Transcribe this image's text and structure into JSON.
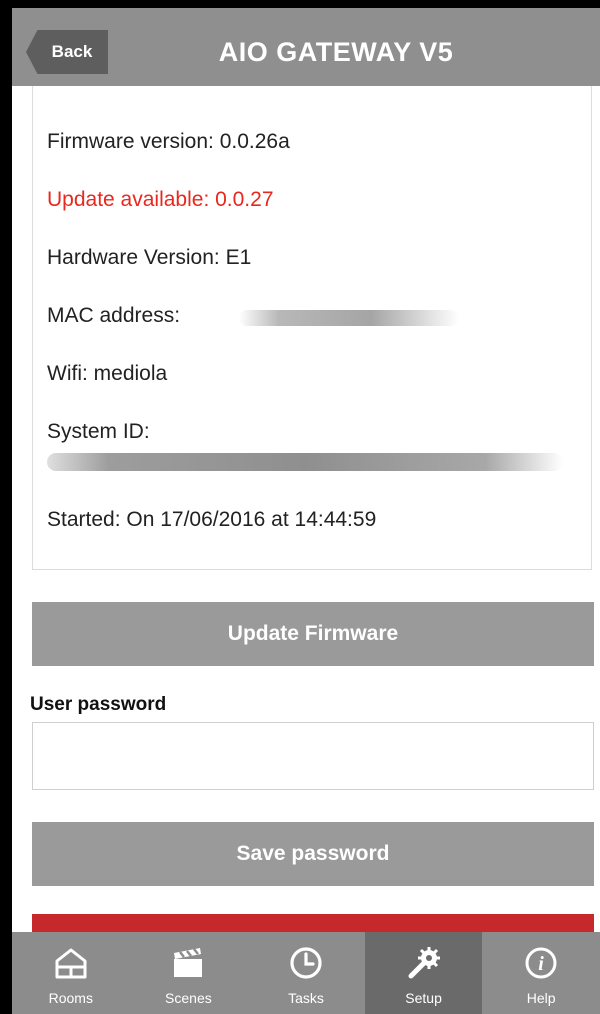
{
  "header": {
    "back_label": "Back",
    "title": "AIO GATEWAY V5"
  },
  "info": {
    "firmware": "Firmware version: 0.0.26a",
    "update": "Update available: 0.0.27",
    "hardware": "Hardware Version: E1",
    "mac_label": "MAC address:",
    "wifi": "Wifi: mediola",
    "system_id_label": "System ID:",
    "started": "Started: On 17/06/2016 at 14:44:59"
  },
  "buttons": {
    "update_firmware": "Update Firmware",
    "save_password": "Save password"
  },
  "password": {
    "label": "User password",
    "value": ""
  },
  "tabs": [
    {
      "label": "Rooms",
      "icon": "house-icon"
    },
    {
      "label": "Scenes",
      "icon": "clapperboard-icon"
    },
    {
      "label": "Tasks",
      "icon": "clock-icon"
    },
    {
      "label": "Setup",
      "icon": "tools-icon",
      "active": true
    },
    {
      "label": "Help",
      "icon": "info-icon"
    }
  ],
  "colors": {
    "header_bg": "#8f8f8f",
    "update_text": "#e8281e",
    "button_bg": "#9a9a9a",
    "tabbar_bg": "#8c8c8c",
    "active_tab_bg": "#6a6a6a",
    "danger": "#c7282c"
  }
}
